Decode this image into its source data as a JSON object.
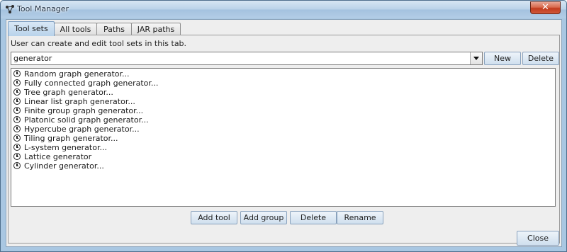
{
  "window": {
    "title": "Tool Manager",
    "close_glyph": "✕"
  },
  "tabs": [
    {
      "label": "Tool sets",
      "active": true
    },
    {
      "label": "All tools",
      "active": false
    },
    {
      "label": "Paths",
      "active": false
    },
    {
      "label": "JAR paths",
      "active": false
    }
  ],
  "description": "User can create and edit tool sets in this tab.",
  "toolset_combo": {
    "value": "generator"
  },
  "top_buttons": {
    "new": "New",
    "delete": "Delete"
  },
  "tools": [
    "Random graph generator...",
    "Fully connected graph generator...",
    "Tree graph generator...",
    "Linear list graph generator...",
    "Finite group graph generator...",
    "Platonic solid graph generator...",
    "Hypercube graph generator...",
    "Tiling graph generator...",
    "L-system generator...",
    "Lattice generator",
    "Cylinder generator..."
  ],
  "bottom_buttons": {
    "add_tool": "Add tool",
    "add_group": "Add group",
    "delete": "Delete",
    "rename": "Rename"
  },
  "close_button": "Close",
  "icons": {
    "app": "graph-app-icon",
    "tool": "clock-icon"
  }
}
